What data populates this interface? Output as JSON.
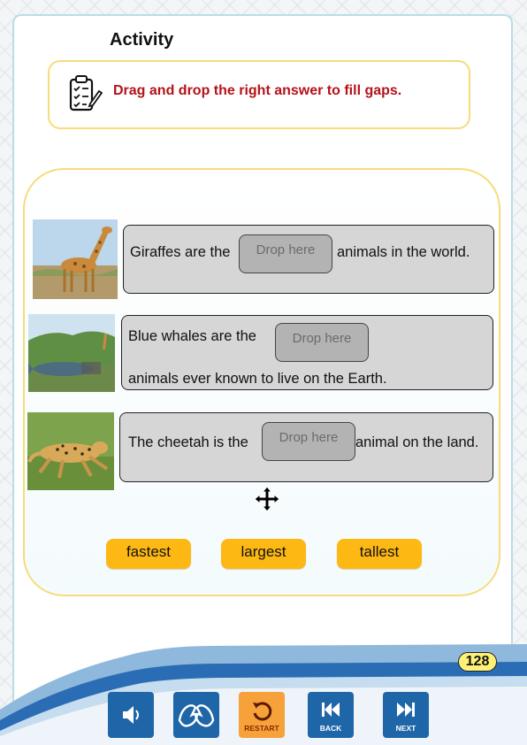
{
  "activity": {
    "title": "Activity",
    "instruction": "Drag and drop the right answer to fill gaps."
  },
  "questions": [
    {
      "before": "Giraffes are the",
      "after": "animals in the world.",
      "drop_label": "Drop here"
    },
    {
      "before": "Blue whales are the",
      "after": "animals ever known to live on the Earth.",
      "drop_label": "Drop here"
    },
    {
      "before": "The cheetah is the",
      "after": "animal on the land.",
      "drop_label": "Drop here"
    }
  ],
  "answers": [
    "fastest",
    "largest",
    "tallest"
  ],
  "footer": {
    "page_number": "128",
    "restart_label": "RESTART",
    "back_label": "BACK",
    "next_label": "NEXT"
  },
  "colors": {
    "instruction_text": "#b5121b",
    "panel_border": "#f6dc7a",
    "answer_button": "#fdb813",
    "nav_button": "#1f66a8",
    "restart_button": "#f7a13a",
    "sentence_box": "#d6d6d6",
    "drop_zone": "#b3b3b3"
  },
  "icons": {
    "instruction": "clipboard-checklist-icon",
    "sound": "speaker-icon",
    "sign_language": "sign-language-icon",
    "restart": "restart-icon",
    "back": "skip-back-icon",
    "next": "skip-next-icon",
    "cursor": "move-cursor-icon"
  }
}
